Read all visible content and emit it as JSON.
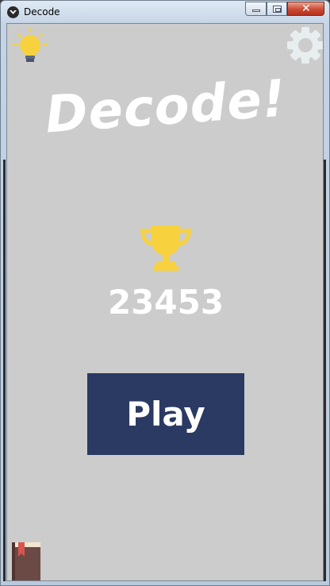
{
  "window": {
    "title": "Decode",
    "minimize_icon": "minimize-icon",
    "maximize_icon": "maximize-icon",
    "close_glyph": "✕"
  },
  "toolbar": {
    "hint_icon": "lightbulb-icon",
    "settings_icon": "gear-icon"
  },
  "game": {
    "logo_text": "Decode!",
    "trophy_icon": "trophy-icon",
    "high_score": "23453",
    "play_label": "Play",
    "rules_icon": "book-icon"
  },
  "colors": {
    "background": "#cccccc",
    "play_button": "#2b3a63",
    "trophy": "#f7d23e",
    "bulb": "#f7d23e",
    "gear": "#e8eef0",
    "book_cover": "#6b4a46",
    "bookmark": "#d9534f",
    "text": "#ffffff"
  }
}
